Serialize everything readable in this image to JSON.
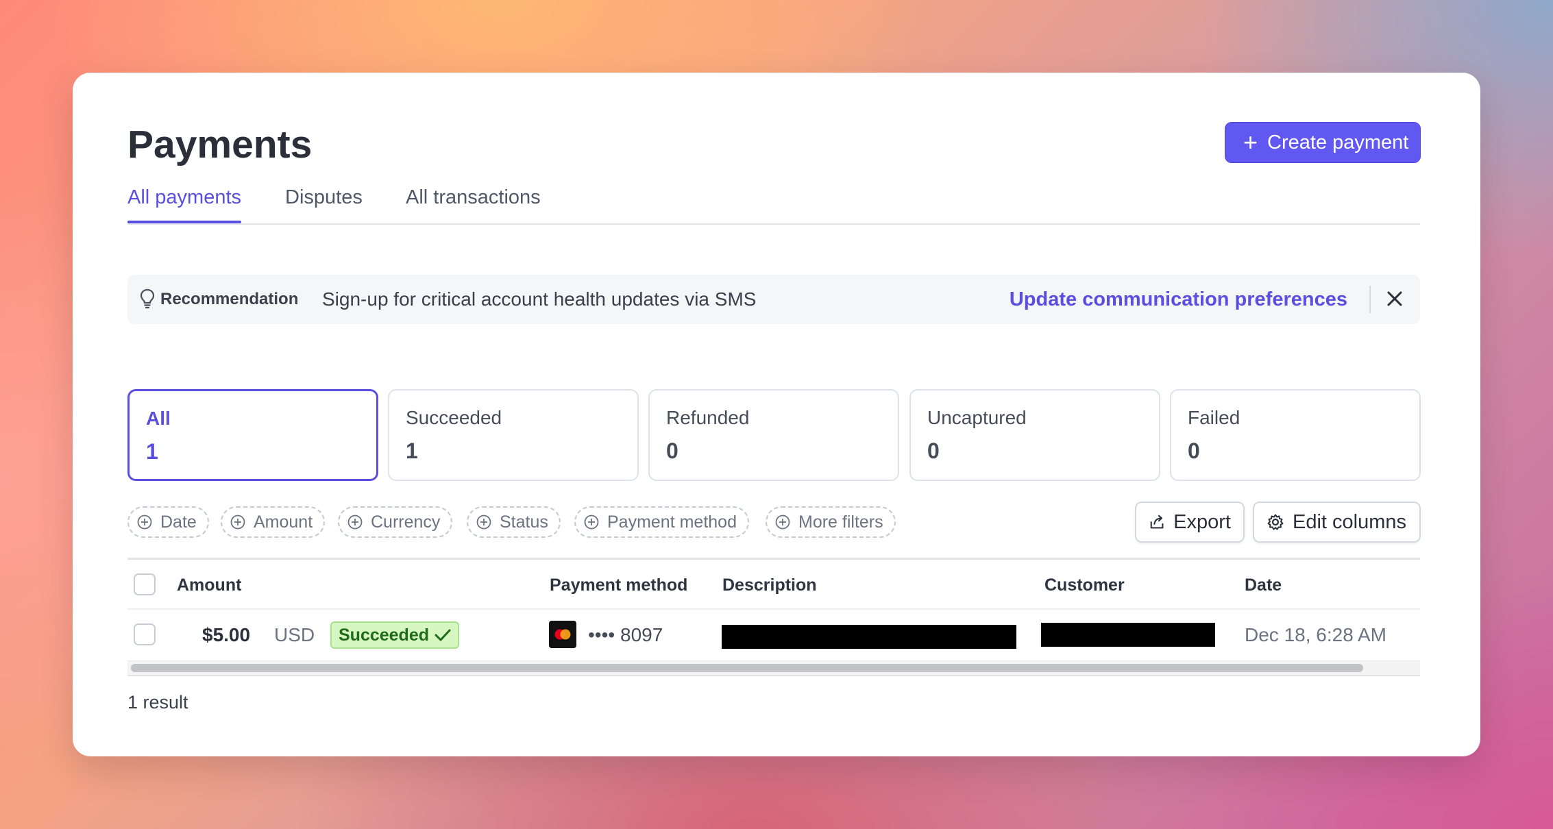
{
  "page": {
    "title": "Payments",
    "create_button": "Create payment"
  },
  "tabs": [
    {
      "label": "All payments",
      "active": true
    },
    {
      "label": "Disputes",
      "active": false
    },
    {
      "label": "All transactions",
      "active": false
    }
  ],
  "banner": {
    "label": "Recommendation",
    "message": "Sign-up for critical account health updates via SMS",
    "link": "Update communication preferences"
  },
  "stats": [
    {
      "label": "All",
      "value": "1",
      "active": true
    },
    {
      "label": "Succeeded",
      "value": "1",
      "active": false
    },
    {
      "label": "Refunded",
      "value": "0",
      "active": false
    },
    {
      "label": "Uncaptured",
      "value": "0",
      "active": false
    },
    {
      "label": "Failed",
      "value": "0",
      "active": false
    }
  ],
  "filters": [
    "Date",
    "Amount",
    "Currency",
    "Status",
    "Payment method",
    "More filters"
  ],
  "toolbar": {
    "export": "Export",
    "edit_columns": "Edit columns"
  },
  "table": {
    "headers": {
      "amount": "Amount",
      "payment_method": "Payment method",
      "description": "Description",
      "customer": "Customer",
      "date": "Date"
    },
    "rows": [
      {
        "amount": "$5.00",
        "currency": "USD",
        "status": "Succeeded",
        "card_icon": "mastercard-icon",
        "card_last4": "•••• 8097",
        "description": "[redacted]",
        "customer": "[redacted]",
        "date": "Dec 18, 6:28 AM"
      }
    ],
    "result_count": "1 result"
  },
  "colors": {
    "accent": "#5a4fe0",
    "button": "#6058f0",
    "success_bg": "#d7f7c2",
    "success_text": "#1f6b18"
  }
}
